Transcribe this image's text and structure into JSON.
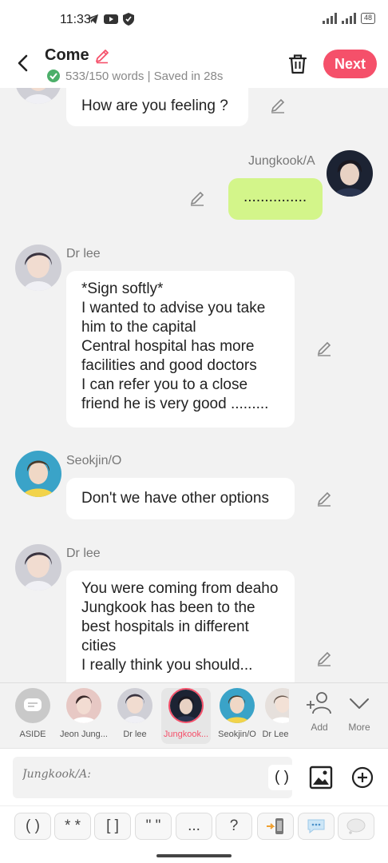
{
  "status": {
    "time": "11:33",
    "battery": "48"
  },
  "header": {
    "title": "Come",
    "subtitle": "533/150 words | Saved in 28s",
    "next_label": "Next"
  },
  "messages": [
    {
      "speaker": "",
      "text": "How are you feeling ?"
    },
    {
      "speaker": "Jungkook/A",
      "text": "..............."
    },
    {
      "speaker": "Dr lee",
      "text": "*Sign softly*\nI wanted to advise you take him to the capital\nCentral hospital has more facilities and good doctors\nI can refer you to a close friend he is very good ........."
    },
    {
      "speaker": "Seokjin/O",
      "text": "Don't we have other options"
    },
    {
      "speaker": "Dr lee",
      "text": "You were coming from deaho\nJungkook has been to the best hospitals in different cities\nI really think you should..."
    }
  ],
  "characters": [
    {
      "label": "ASIDE"
    },
    {
      "label": "Jeon Jung..."
    },
    {
      "label": "Dr lee"
    },
    {
      "label": "Jungkook..."
    },
    {
      "label": "Seokjin/O"
    },
    {
      "label": "Dr Lee"
    }
  ],
  "character_actions": {
    "add_label": "Add",
    "more_label": "More"
  },
  "input": {
    "placeholder": "Jungkook/A:",
    "paren_label": "( )"
  },
  "toolbar": [
    "( )",
    "* *",
    "[ ]",
    "\" \"",
    "...",
    "?"
  ],
  "colors": {
    "accent": "#f5506a",
    "mine_bubble": "#d3f58a",
    "background": "#f2f2f2"
  }
}
